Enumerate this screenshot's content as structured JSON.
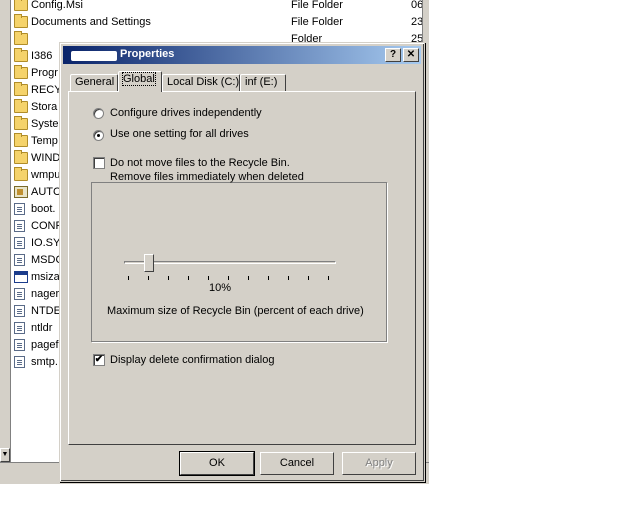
{
  "explorer": {
    "rows": [
      {
        "name": "Config.Msi",
        "type": "File Folder",
        "modified": "06.",
        "icon": "folder-icon"
      },
      {
        "name": "Documents and Settings",
        "type": "File Folder",
        "modified": "23.",
        "icon": "folder-icon"
      },
      {
        "name": "",
        "type": "Folder",
        "modified": "25",
        "icon": "folder-icon"
      },
      {
        "name": "I386",
        "type": "",
        "modified": "",
        "icon": "folder-icon"
      },
      {
        "name": "Progr",
        "type": "",
        "modified": "",
        "icon": "folder-icon"
      },
      {
        "name": "RECY",
        "type": "",
        "modified": "",
        "icon": "folder-icon"
      },
      {
        "name": "Stora",
        "type": "",
        "modified": "",
        "icon": "folder-icon"
      },
      {
        "name": "Syste",
        "type": "",
        "modified": "",
        "icon": "folder-icon"
      },
      {
        "name": "Temp",
        "type": "",
        "modified": "",
        "icon": "folder-icon"
      },
      {
        "name": "WIND",
        "type": "",
        "modified": "",
        "icon": "folder-icon"
      },
      {
        "name": "wmpu",
        "type": "",
        "modified": "",
        "icon": "folder-icon"
      },
      {
        "name": "AUTC",
        "type": "",
        "modified": "",
        "icon": "bat-icon"
      },
      {
        "name": "boot.",
        "type": "",
        "modified": "",
        "icon": "file-icon"
      },
      {
        "name": "CONF",
        "type": "",
        "modified": "",
        "icon": "file-icon"
      },
      {
        "name": "IO.SY",
        "type": "",
        "modified": "",
        "icon": "file-icon"
      },
      {
        "name": "MSDC",
        "type": "",
        "modified": "",
        "icon": "file-icon"
      },
      {
        "name": "msiza",
        "type": "",
        "modified": "",
        "icon": "exe-icon"
      },
      {
        "name": "nager",
        "type": "",
        "modified": "",
        "icon": "file-icon"
      },
      {
        "name": "NTDE",
        "type": "",
        "modified": "",
        "icon": "file-icon"
      },
      {
        "name": "ntldr",
        "type": "",
        "modified": "",
        "icon": "file-icon"
      },
      {
        "name": "pagef",
        "type": "",
        "modified": "",
        "icon": "file-icon"
      },
      {
        "name": "smtp.",
        "type": "",
        "modified": "",
        "icon": "file-icon"
      }
    ]
  },
  "dialog": {
    "title": "Properties",
    "help_label": "?",
    "close_label": "✕",
    "tabs": [
      {
        "label": "General"
      },
      {
        "label": "Global"
      },
      {
        "label": "Local Disk (C:)"
      },
      {
        "label": "inf (E:)"
      }
    ],
    "active_tab": "Global",
    "options": {
      "configure_independently": "Configure drives independently",
      "use_one_setting": "Use one setting for all drives",
      "selected": "use_one_setting"
    },
    "do_not_move": {
      "line1": "Do not move files to the Recycle Bin.",
      "line2": "Remove files immediately when deleted",
      "checked": false
    },
    "slider": {
      "value_text": "10%",
      "value_fraction": 0.1,
      "caption": "Maximum size of Recycle Bin (percent of each drive)"
    },
    "display_confirm": {
      "label": "Display delete confirmation dialog",
      "checked": true,
      "check_glyph": "✔"
    },
    "buttons": {
      "ok": "OK",
      "cancel": "Cancel",
      "apply": "Apply"
    }
  }
}
